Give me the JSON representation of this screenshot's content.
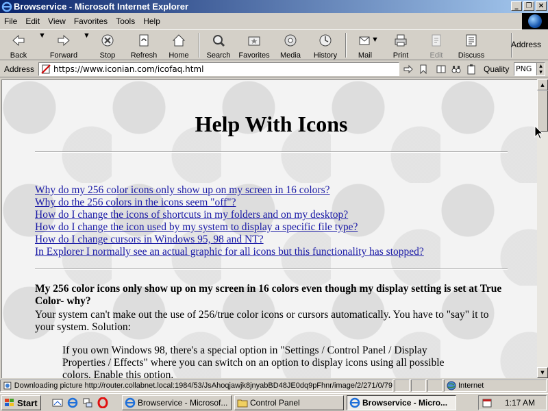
{
  "window": {
    "title": "Browservice - Microsoft Internet Explorer",
    "controls": {
      "minimize": "_",
      "restore": "❐",
      "close": "×"
    }
  },
  "menu": [
    {
      "label": "File"
    },
    {
      "label": "Edit"
    },
    {
      "label": "View"
    },
    {
      "label": "Favorites"
    },
    {
      "label": "Tools"
    },
    {
      "label": "Help"
    }
  ],
  "toolbar": {
    "back": "Back",
    "forward": "Forward",
    "stop": "Stop",
    "refresh": "Refresh",
    "home": "Home",
    "search": "Search",
    "favorites": "Favorites",
    "media": "Media",
    "history": "History",
    "mail": "Mail",
    "print": "Print",
    "edit": "Edit",
    "discuss": "Discuss",
    "address": "Address"
  },
  "address_bar": {
    "label": "Address",
    "url": "https://www.iconian.com/icofaq.html",
    "quality_label": "Quality",
    "quality_value": "PNG"
  },
  "page": {
    "title": "Help With Icons",
    "links": [
      "Why do my 256 color icons only show up on my screen in 16 colors?",
      "Why do the 256 colors in the icons seem \"off\"?",
      "How do I change the icons of shortcuts in my folders and on my desktop?",
      "How do I change the icon used by my system to display a specific file type?",
      "How do I change cursors in Windows 95, 98 and NT?",
      "In Explorer I normally see an actual graphic for all icons but this functionality has stopped?"
    ],
    "question_heading": "My 256 color icons only show up on my screen in 16 colors even though my display setting is set at True Color- why?",
    "answer": "Your system can't make out the use of 256/true color icons or cursors automatically. You have to \"say\" it to your system. Solution:",
    "indent_text": "If you own Windows 98, there's a special option in \"Settings / Control Panel / Display Properties / Effects\" where you can switch on an option to display icons using all possible colors. Enable this option."
  },
  "status_bar": {
    "text": "Downloading picture http://router.collabnet.local:1984/53/JsAhoqjawjk8jnyabBD48JE0dq9pFhnr/image/2/271/0/79",
    "zone": "Internet"
  },
  "taskbar": {
    "start": "Start",
    "tasks": [
      {
        "label": "Browservice - Microsof..."
      },
      {
        "label": "Control Panel"
      },
      {
        "label": "Browservice - Micro..."
      }
    ],
    "clock": "1:17 AM"
  }
}
